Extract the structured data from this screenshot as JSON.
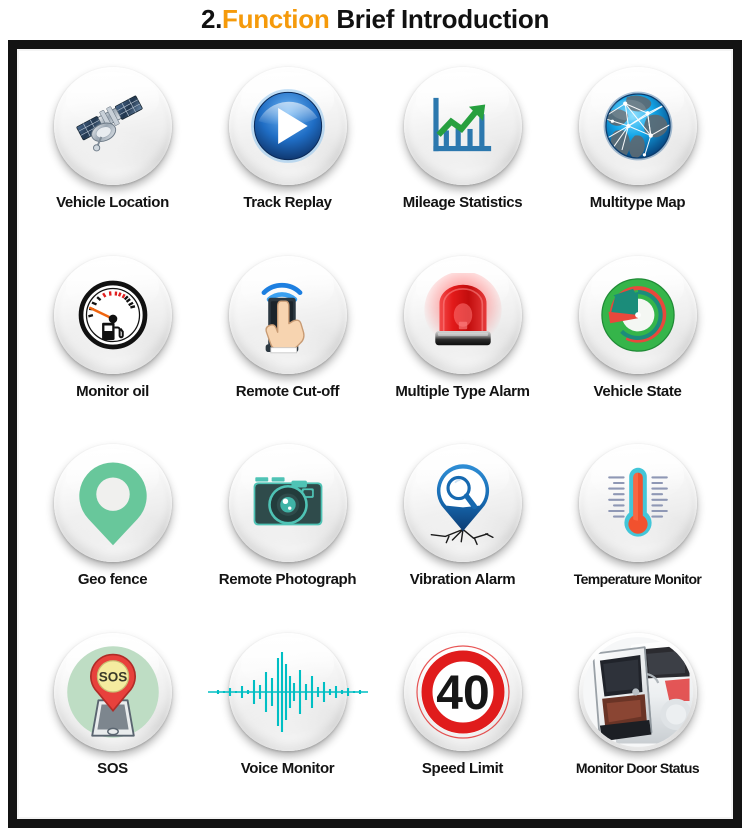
{
  "header": {
    "number": "2.",
    "highlight": "Function",
    "rest": " Brief Introduction",
    "highlight_color": "#F59A0B",
    "text_color": "#111111"
  },
  "frame": {
    "border_color": "#131313",
    "background": "#ffffff"
  },
  "features": [
    {
      "id": "vehicle-location",
      "label": "Vehicle Location",
      "icon": "satellite-icon"
    },
    {
      "id": "track-replay",
      "label": "Track Replay",
      "icon": "play-button-icon"
    },
    {
      "id": "mileage-statistics",
      "label": "Mileage Statistics",
      "icon": "bar-chart-up-icon"
    },
    {
      "id": "multitype-map",
      "label": "Multitype Map",
      "icon": "globe-network-icon"
    },
    {
      "id": "monitor-oil",
      "label": "Monitor oil",
      "icon": "fuel-gauge-icon"
    },
    {
      "id": "remote-cut-off",
      "label": "Remote Cut-off",
      "icon": "phone-touch-wifi-icon"
    },
    {
      "id": "multiple-type-alarm",
      "label": "Multiple Type Alarm",
      "icon": "siren-light-icon"
    },
    {
      "id": "vehicle-state",
      "label": "Vehicle State",
      "icon": "pie-dial-icon"
    },
    {
      "id": "geo-fence",
      "label": "Geo fence",
      "icon": "map-pin-ring-icon"
    },
    {
      "id": "remote-photograph",
      "label": "Remote Photograph",
      "icon": "camera-icon"
    },
    {
      "id": "vibration-alarm",
      "label": "Vibration Alarm",
      "icon": "pin-magnifier-crack-icon"
    },
    {
      "id": "temperature-monitor",
      "label": "Temperature Monitor",
      "icon": "thermometer-icon"
    },
    {
      "id": "sos",
      "label": "SOS",
      "icon": "sos-pin-phone-icon"
    },
    {
      "id": "voice-monitor",
      "label": "Voice Monitor",
      "icon": "audio-waveform-icon"
    },
    {
      "id": "speed-limit",
      "label": "Speed Limit",
      "icon": "speed-limit-sign-icon"
    },
    {
      "id": "monitor-door-status",
      "label": "Monitor Door Status",
      "icon": "car-open-door-icon"
    }
  ],
  "icon_values": {
    "speed_limit_number": "40",
    "sos_text": "SOS"
  },
  "colors": {
    "play_blue": "#1A63B8",
    "chart_blue": "#2C78AE",
    "chart_green": "#27A03F",
    "globe_blue": "#1CA0E0",
    "gauge_orange": "#F0650F",
    "wifi_blue": "#2196F3",
    "siren_red": "#E8191E",
    "state_green": "#35B54A",
    "state_teal": "#1B8C7A",
    "geo_green": "#68C79B",
    "camera_dark": "#2F4B4B",
    "camera_teal": "#4FC3B5",
    "pin_blue": "#1669B0",
    "thermo_cyan": "#43C6D8",
    "thermo_red": "#F1512E",
    "sos_bg": "#BEDDC4",
    "sos_red": "#E8413C",
    "sos_yellow": "#F5ECA0",
    "wave_teal": "#00BFC4",
    "sign_red": "#E01C1C"
  }
}
